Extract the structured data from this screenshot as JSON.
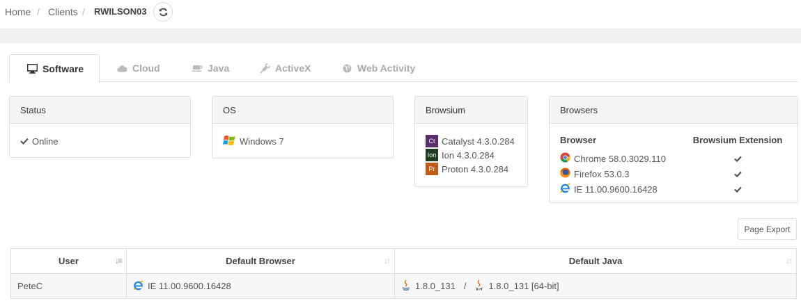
{
  "breadcrumb": {
    "home": "Home",
    "sep1": "/",
    "clients": "Clients",
    "sep2": "/",
    "current": "RWILSON03"
  },
  "tabs": [
    {
      "label": "Software",
      "icon": "monitor-icon",
      "active": true
    },
    {
      "label": "Cloud",
      "icon": "cloud-icon"
    },
    {
      "label": "Java",
      "icon": "coffee-icon"
    },
    {
      "label": "ActiveX",
      "icon": "plug-icon"
    },
    {
      "label": "Web Activity",
      "icon": "globe-icon"
    }
  ],
  "status": {
    "title": "Status",
    "value": "Online"
  },
  "os": {
    "title": "OS",
    "value": "Windows 7"
  },
  "browsium": {
    "title": "Browsium",
    "items": [
      {
        "abbr": "Ct",
        "label": "Catalyst 4.3.0.284",
        "color": "#5c2d6e"
      },
      {
        "abbr": "Ion",
        "label": "Ion 4.3.0.284",
        "color": "#1f3d1f"
      },
      {
        "abbr": "Pr",
        "label": "Proton 4.3.0.284",
        "color": "#c05a15"
      }
    ]
  },
  "browsers": {
    "title": "Browsers",
    "col_browser": "Browser",
    "col_extension": "Browsium Extension",
    "items": [
      {
        "label": "Chrome 58.0.3029.110",
        "icon": "chrome-icon"
      },
      {
        "label": "Firefox 53.0.3",
        "icon": "firefox-icon"
      },
      {
        "label": "IE 11.00.9600.16428",
        "icon": "ie-icon"
      }
    ]
  },
  "export": {
    "label": "Page Export"
  },
  "user_table": {
    "headers": [
      "User",
      "Default Browser",
      "Default Java"
    ],
    "rows": [
      {
        "user": "PeteC",
        "browser": "IE 11.00.9600.16428",
        "java_32": "1.8.0_131",
        "java_sep": "/",
        "java_64": "1.8.0_131 [64-bit]"
      }
    ]
  },
  "colors": {
    "accent_check": "#555555",
    "panel_header": "#f5f5f5"
  }
}
